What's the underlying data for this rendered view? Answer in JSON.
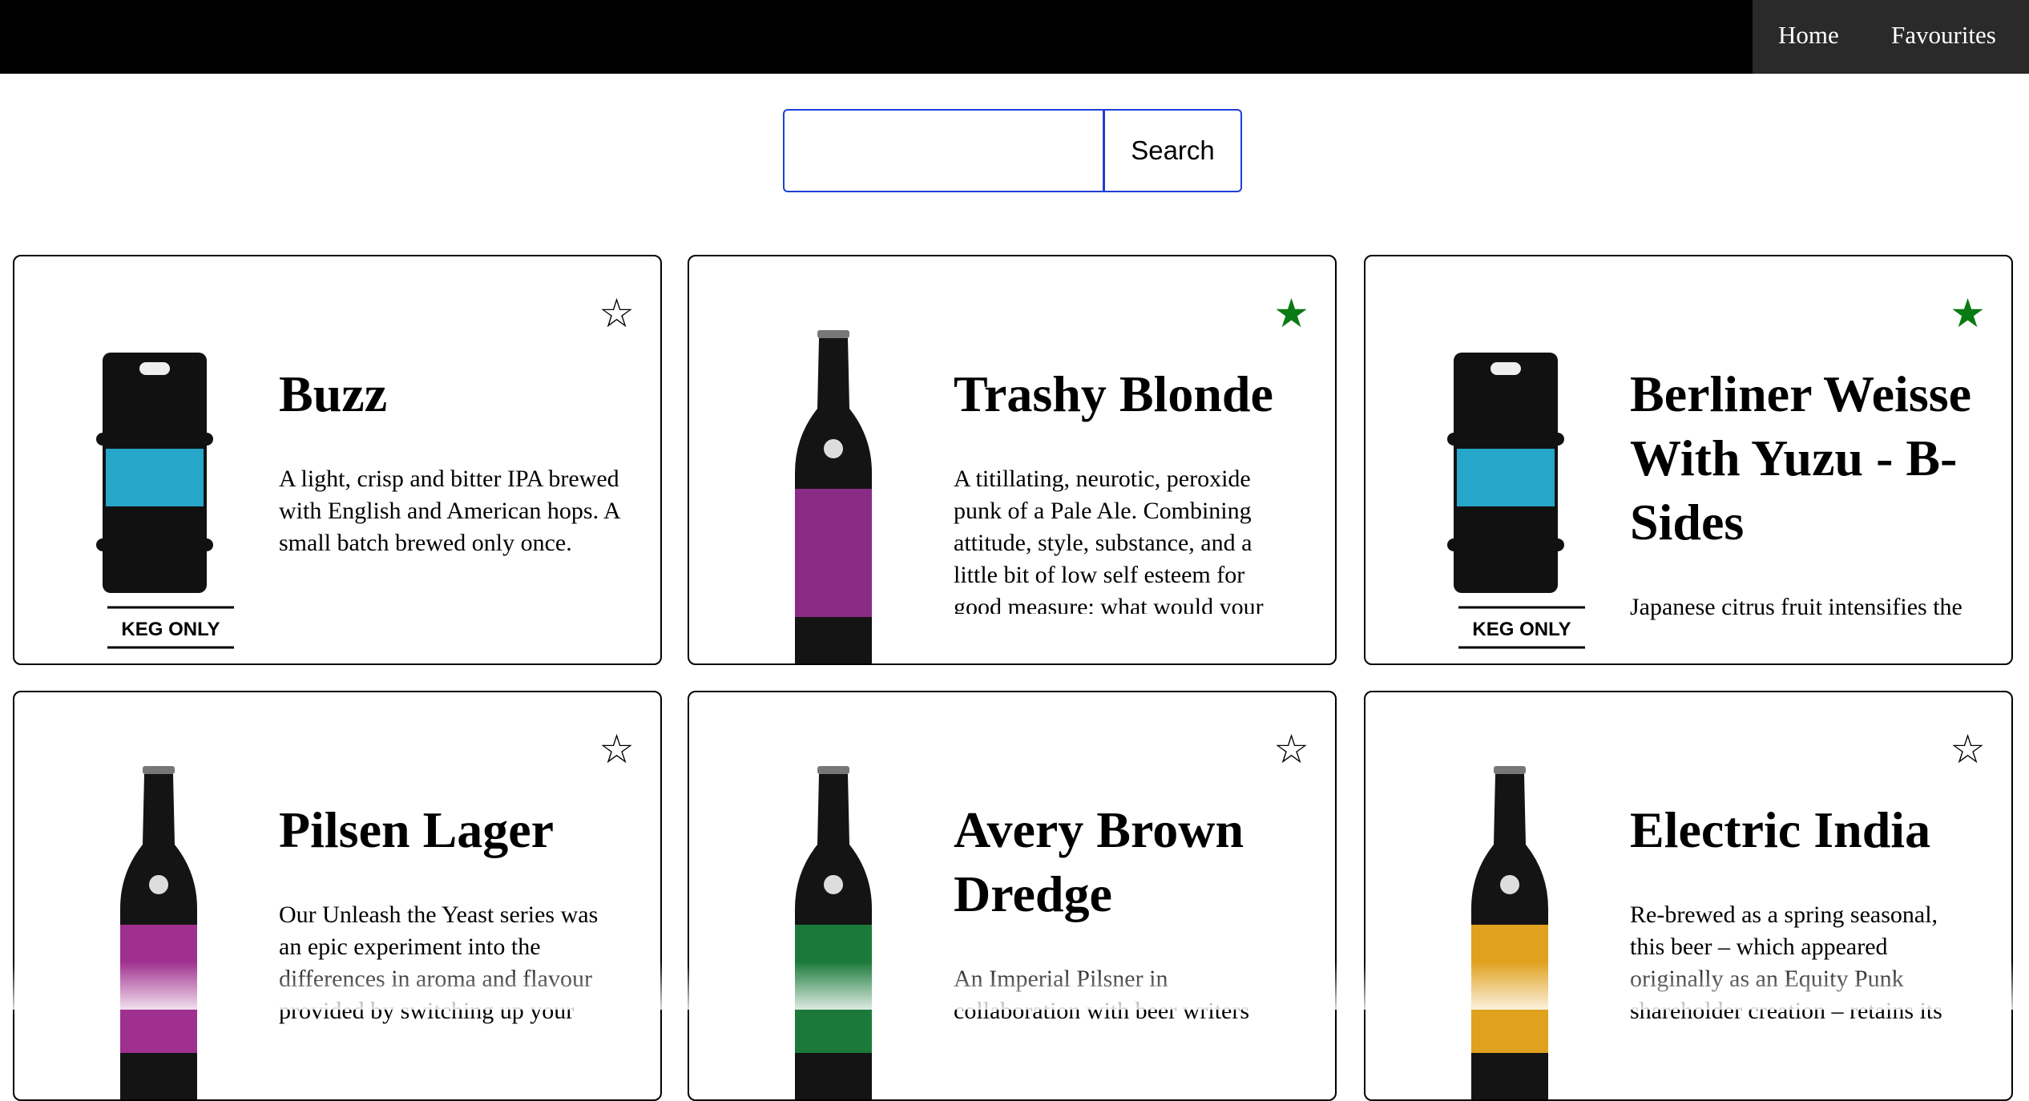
{
  "nav": {
    "home_label": "Home",
    "favourites_label": "Favourites"
  },
  "search": {
    "button_label": "Search",
    "value": "",
    "placeholder": ""
  },
  "cards": [
    {
      "name": "Buzz",
      "favourite": false,
      "image": "keg",
      "label_color": "#26a6c9",
      "keg_label": "KEG ONLY",
      "description": "A light, crisp and bitter IPA brewed with English and American hops. A small batch brewed only once."
    },
    {
      "name": "Trashy Blonde",
      "favourite": true,
      "image": "bottle",
      "label_color": "#8a2c86",
      "description": "A titillating, neurotic, peroxide punk of a Pale Ale. Combining attitude, style, substance, and a little bit of low self esteem for good measure; what would your"
    },
    {
      "name": "Berliner Weisse With Yuzu - B-Sides",
      "favourite": true,
      "image": "keg",
      "label_color": "#26a6c9",
      "keg_label": "KEG ONLY",
      "description": "Japanese citrus fruit intensifies the"
    },
    {
      "name": "Pilsen Lager",
      "favourite": false,
      "image": "bottle",
      "label_color": "#a0308f",
      "description": "Our Unleash the Yeast series was an epic experiment into the differences in aroma and flavour provided by switching up your"
    },
    {
      "name": "Avery Brown Dredge",
      "favourite": false,
      "image": "bottle",
      "label_color": "#1b7a3a",
      "description": "An Imperial Pilsner in collaboration with beer writers"
    },
    {
      "name": "Electric India",
      "favourite": false,
      "image": "bottle",
      "label_color": "#e0a11e",
      "description": "Re-brewed as a spring seasonal, this beer – which appeared originally as an Equity Punk shareholder creation – retains its"
    }
  ],
  "icons": {
    "favourite_on": "star-filled-icon",
    "favourite_off": "star-outline-icon"
  },
  "colors": {
    "favourite_on": "#0a7a14",
    "accent": "#1f3fd8"
  }
}
